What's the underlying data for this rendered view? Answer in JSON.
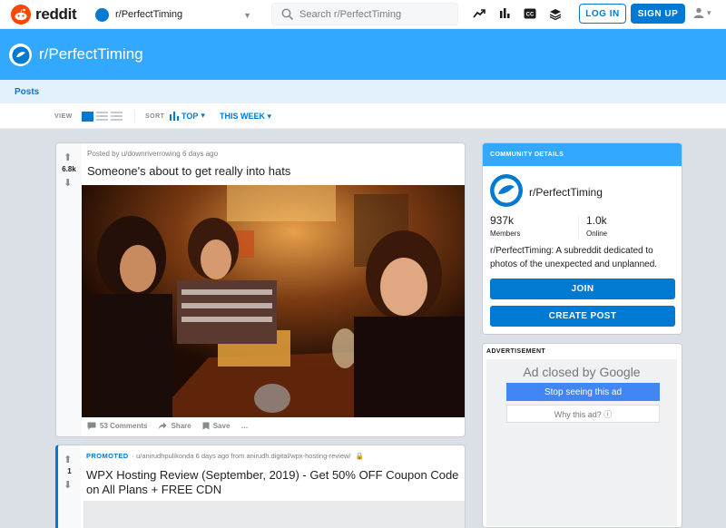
{
  "header": {
    "logo_text": "reddit",
    "subreddit_select": "r/PerfectTiming",
    "search_placeholder": "Search r/PerfectTiming",
    "login_label": "LOG IN",
    "signup_label": "SIGN UP"
  },
  "banner": {
    "title": "r/PerfectTiming"
  },
  "tabs": {
    "posts": "Posts"
  },
  "sortbar": {
    "view_label": "VIEW",
    "sort_label": "SORT",
    "sort_value": "TOP",
    "time_value": "THIS WEEK"
  },
  "post": {
    "votes": "6.8k",
    "meta": "Posted by u/downriverrowing 6 days ago",
    "title": "Someone's about to get really into hats",
    "comments": "53 Comments",
    "share": "Share",
    "save": "Save",
    "more": "…"
  },
  "promo": {
    "votes": "1",
    "promoted_label": "PROMOTED",
    "meta": "· u/anirudhpulikonda 6 days ago from anirudh.digital/wpx-hosting-review/",
    "title": "WPX Hosting Review (September, 2019) - Get 50% OFF Coupon Code on All Plans + FREE CDN"
  },
  "community": {
    "header": "COMMUNITY DETAILS",
    "name": "r/PerfectTiming",
    "members_value": "937k",
    "members_label": "Members",
    "online_value": "1.0k",
    "online_label": "Online",
    "description": "r/PerfectTiming: A subreddit dedicated to photos of the unexpected and unplanned.",
    "join_label": "JOIN",
    "create_post_label": "CREATE POST"
  },
  "ad": {
    "label": "ADVERTISEMENT",
    "closed_prefix": "Ad closed by",
    "closed_brand": "Google",
    "stop_label": "Stop seeing this ad",
    "why_label": "Why this ad? ⓘ"
  },
  "colors": {
    "accent": "#0079d3",
    "banner": "#33a8ff",
    "reddit_orange": "#ff4500",
    "background": "#dae0e6"
  }
}
